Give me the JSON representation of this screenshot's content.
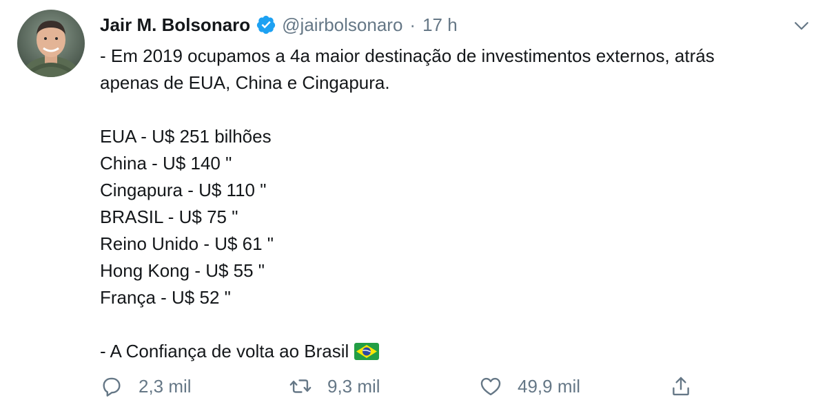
{
  "tweet": {
    "author_name": "Jair M. Bolsonaro",
    "handle": "@jairbolsonaro",
    "separator": "·",
    "time": "17 h",
    "lines": [
      "- Em 2019 ocupamos a 4a maior destinação de investimentos externos, atrás",
      "apenas de EUA, China e Cingapura.",
      "",
      "EUA - U$ 251 bilhões",
      "China - U$ 140 \"",
      "Cingapura - U$ 110 \"",
      "BRASIL - U$ 75 \"",
      "Reino Unido - U$ 61 \"",
      "Hong Kong - U$ 55 \"",
      "França - U$ 52 \"",
      "",
      "- A Confiança de volta ao Brasil"
    ],
    "emoji": "brazil-flag"
  },
  "actions": {
    "reply_count": "2,3 mil",
    "retweet_count": "9,3 mil",
    "like_count": "49,9 mil"
  },
  "icons": {
    "verified": "verified-badge-icon",
    "menu": "chevron-down-icon",
    "reply": "reply-icon",
    "retweet": "retweet-icon",
    "like": "heart-icon",
    "share": "share-icon"
  },
  "colors": {
    "text_primary": "#14171a",
    "text_secondary": "#657786",
    "verified_blue": "#1da1f2",
    "background": "#ffffff"
  }
}
